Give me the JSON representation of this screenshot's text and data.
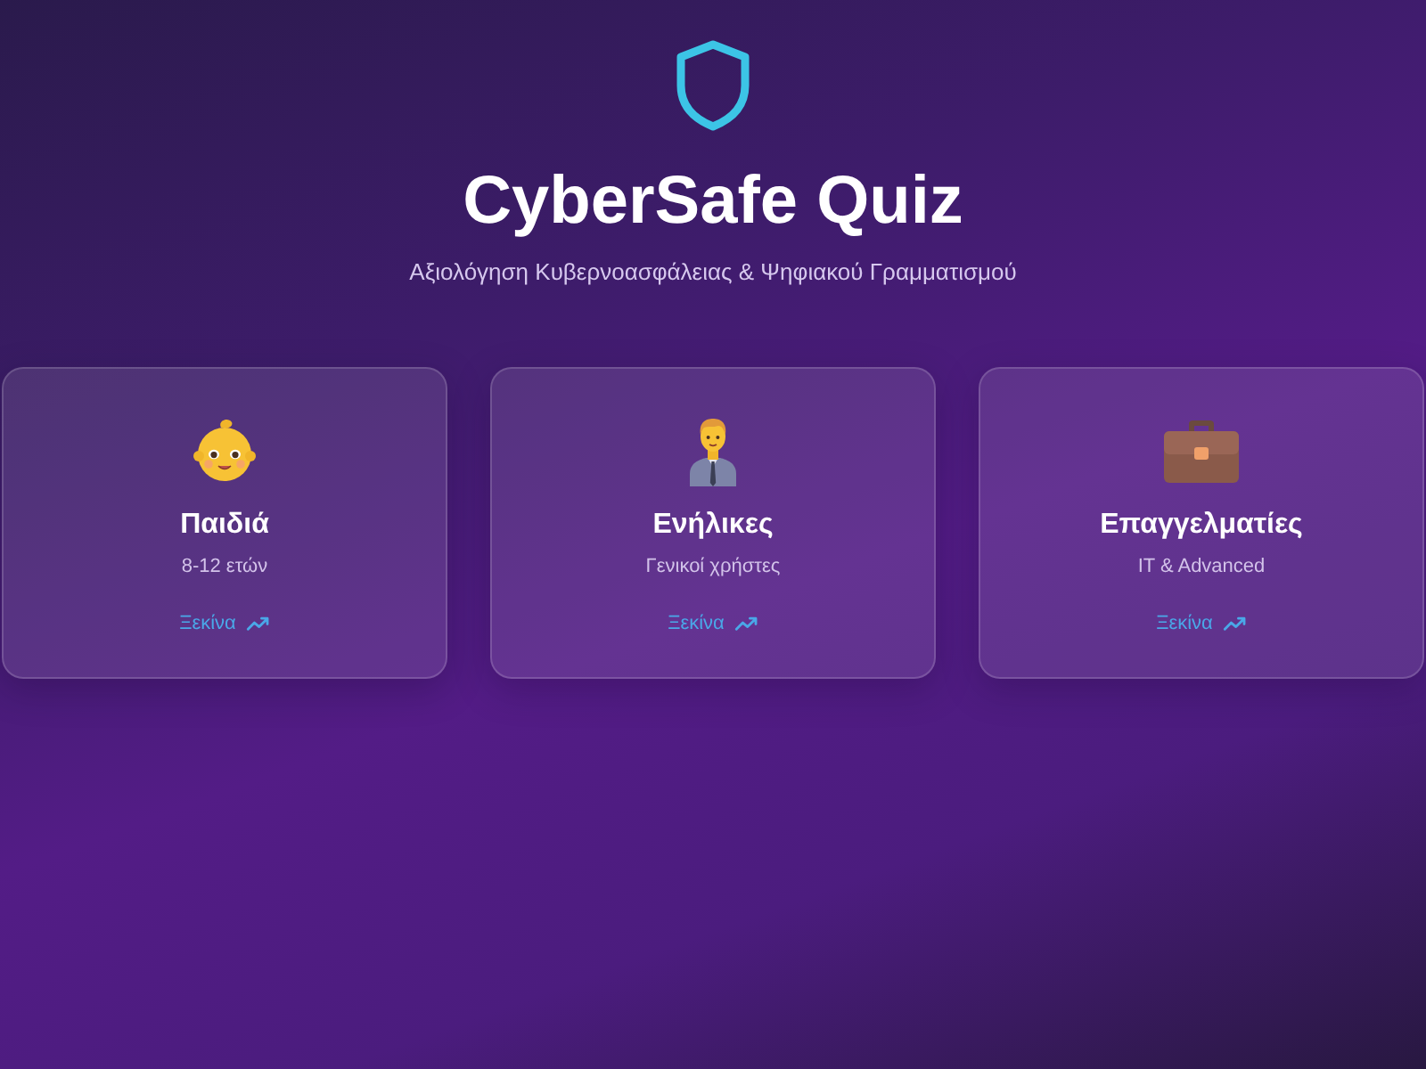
{
  "header": {
    "title": "CyberSafe Quiz",
    "subtitle": "Αξιολόγηση Κυβερνοασφάλειας & Ψηφιακού Γραμματισμού"
  },
  "cards": [
    {
      "kind": "child",
      "title": "Παιδιά",
      "subtitle": "8-12 ετών",
      "action": "Ξεκίνα"
    },
    {
      "kind": "adult",
      "title": "Ενήλικες",
      "subtitle": "Γενικοί χρήστες",
      "action": "Ξεκίνα"
    },
    {
      "kind": "professional",
      "title": "Επαγγελματίες",
      "subtitle": "IT & Advanced",
      "action": "Ξεκίνα"
    }
  ]
}
